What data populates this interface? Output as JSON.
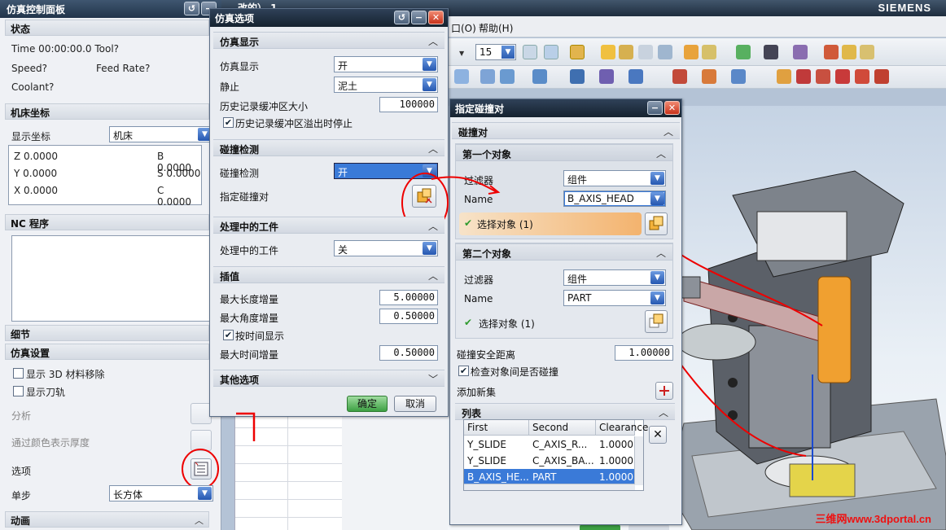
{
  "brand": "SIEMENS",
  "bg_window": {
    "title_fragment": "改的）  1",
    "menu": [
      {
        "label": "口(O)"
      },
      {
        "label": "帮助(H)"
      }
    ],
    "zoom_value": "15",
    "watermark": "三维网www.3dportal.cn"
  },
  "control_panel": {
    "title": "仿真控制面板",
    "status": {
      "heading": "状态",
      "time": "Time 00:00:00.0 Tool?",
      "speed": "Speed?",
      "feed_rate": "Feed Rate?",
      "coolant": "Coolant?"
    },
    "machine_coords": {
      "heading": "机床坐标",
      "display_label": "显示坐标",
      "display_value": "机床",
      "z": "Z 0.0000",
      "b": "B 0.0000",
      "y": "Y 0.0000",
      "s": "S 0.0000",
      "x": "X 0.0000",
      "c": "C 0.0000"
    },
    "nc_program": {
      "heading": "NC 程序"
    },
    "detail": {
      "heading": "细节"
    },
    "sim_settings": {
      "heading": "仿真设置",
      "show_3d_material_removal": "显示 3D 材料移除",
      "show_tool_path": "显示刀轨",
      "analysis": "分析",
      "color_thickness": "通过颜色表示厚度",
      "options": "选项",
      "step_label": "单步",
      "step_value": "长方体"
    },
    "animation": {
      "heading": "动画"
    }
  },
  "sim_options": {
    "title": "仿真选项",
    "display_group": {
      "heading": "仿真显示",
      "sim_display_label": "仿真显示",
      "sim_display_value": "开",
      "static_label": "静止",
      "static_value": "泥土",
      "history_buffer_label": "历史记录缓冲区大小",
      "history_buffer_value": "100000",
      "stop_on_overflow_label": "历史记录缓冲区溢出时停止"
    },
    "collision_group": {
      "heading": "碰撞检测",
      "collision_label": "碰撞检测",
      "collision_value": "开",
      "specify_pairs_label": "指定碰撞对"
    },
    "workpiece_group": {
      "heading": "处理中的工件",
      "label": "处理中的工件",
      "value": "关"
    },
    "interp_group": {
      "heading": "插值",
      "max_length_label": "最大长度增量",
      "max_length_value": "5.00000",
      "max_angle_label": "最大角度增量",
      "max_angle_value": "0.50000",
      "by_time_label": "按时间显示",
      "max_time_label": "最大时间增量",
      "max_time_value": "0.50000"
    },
    "other_group": {
      "heading": "其他选项"
    },
    "ok": "确定",
    "cancel": "取消"
  },
  "collision_pair": {
    "title": "指定碰撞对",
    "heading": "碰撞对",
    "first": {
      "heading": "第一个对象",
      "filter_label": "过滤器",
      "filter_value": "组件",
      "name_label": "Name",
      "name_value": "B_AXIS_HEAD",
      "select_label": "选择对象 (1)"
    },
    "second": {
      "heading": "第二个对象",
      "filter_label": "过滤器",
      "filter_value": "组件",
      "name_label": "Name",
      "name_value": "PART",
      "select_label": "选择对象 (1)"
    },
    "safe_distance_label": "碰撞安全距离",
    "safe_distance_value": "1.00000",
    "check_between_label": "检查对象间是否碰撞",
    "add_new_set_label": "添加新集",
    "list": {
      "heading": "列表",
      "columns": [
        "First",
        "Second",
        "Clearance"
      ],
      "rows": [
        {
          "first": "Y_SLIDE",
          "second": "C_AXIS_R...",
          "clearance": "1.0000"
        },
        {
          "first": "Y_SLIDE",
          "second": "C_AXIS_BA...",
          "clearance": "1.0000"
        },
        {
          "first": "B_AXIS_HE...",
          "second": "PART",
          "clearance": "1.0000"
        }
      ]
    }
  }
}
